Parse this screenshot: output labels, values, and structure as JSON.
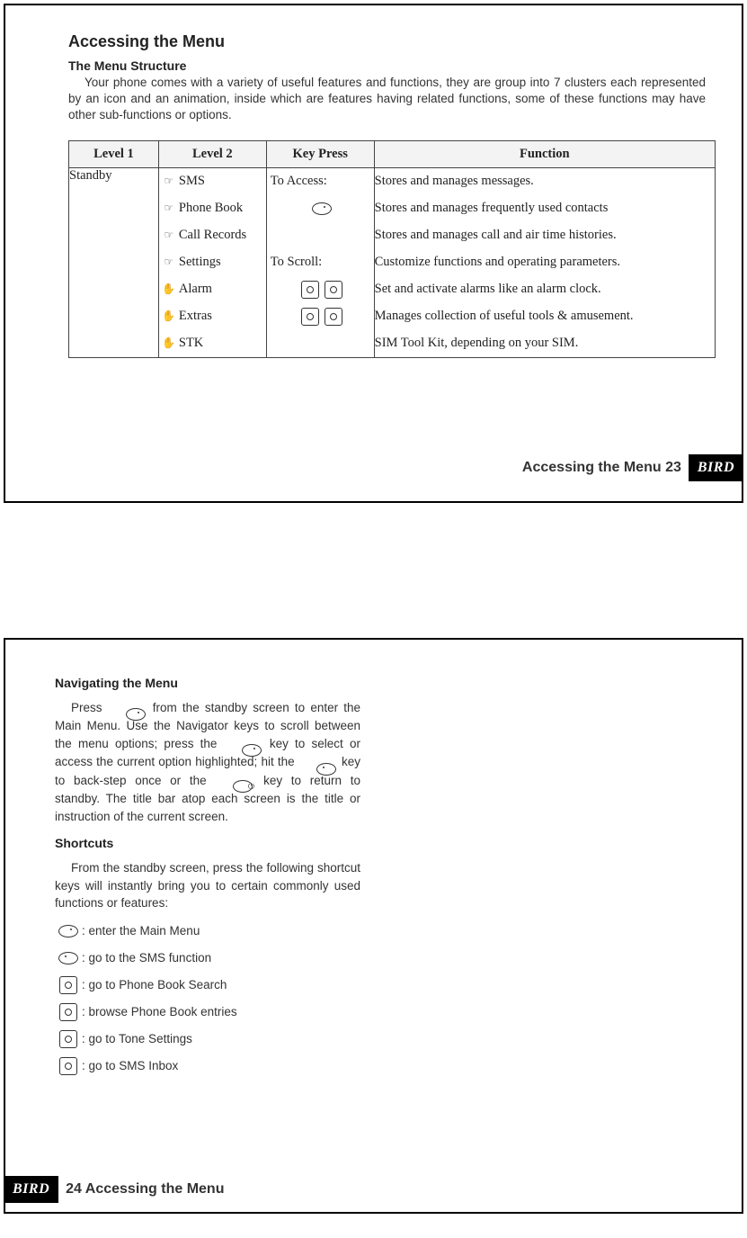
{
  "page1": {
    "title": "Accessing the Menu",
    "subheading": "The Menu Structure",
    "intro": "Your phone comes with a variety of useful features and functions, they are group into 7 clusters each represented by an icon and an animation, inside which are features having related functions, some of these functions may have other sub-functions or options.",
    "table": {
      "headers": {
        "c1": "Level 1",
        "c2": "Level 2",
        "c3": "Key Press",
        "c4": "Function"
      },
      "level1": "Standby",
      "keypress": {
        "access": "To Access:",
        "scroll": "To Scroll:"
      },
      "rows": [
        {
          "l2": "SMS",
          "fn": "Stores and manages messages."
        },
        {
          "l2": "Phone Book",
          "fn": "Stores and manages frequently used contacts"
        },
        {
          "l2": "Call Records",
          "fn": "Stores and manages call and air time histories."
        },
        {
          "l2": "Settings",
          "fn": "Customize functions and operating parameters."
        },
        {
          "l2": "Alarm",
          "fn": "Set and activate alarms like an alarm clock."
        },
        {
          "l2": "Extras",
          "fn": "Manages collection of useful tools  &  amusement."
        },
        {
          "l2": "STK",
          "fn": "SIM Tool Kit, depending on your SIM."
        }
      ]
    },
    "footer": "Accessing the Menu 23",
    "brand": "BIRD"
  },
  "page2": {
    "h1": "Navigating the Menu",
    "para1a": "Press ",
    "para1b": " from the standby screen to enter the Main Menu. Use the Navigator keys to scroll between the menu options; press the ",
    "para1c": " key to select  or access the current option highlighted; hit the ",
    "para1d": " key to back-step once or the ",
    "para1e": " key to return to standby. The title bar atop each screen is the title or instruction of the current screen.",
    "h2": "Shortcuts",
    "para2": "From the standby screen, press the following shortcut keys will instantly bring you to certain commonly used functions or features:",
    "shortcuts": [
      {
        "label": ": enter the Main Menu"
      },
      {
        "label": ": go to the SMS function"
      },
      {
        "label": ": go to Phone Book Search"
      },
      {
        "label": ": browse Phone Book entries"
      },
      {
        "label": ": go to Tone Settings"
      },
      {
        "label": ": go to SMS Inbox"
      }
    ],
    "footer": "24 Accessing the Menu",
    "brand": "BIRD"
  }
}
